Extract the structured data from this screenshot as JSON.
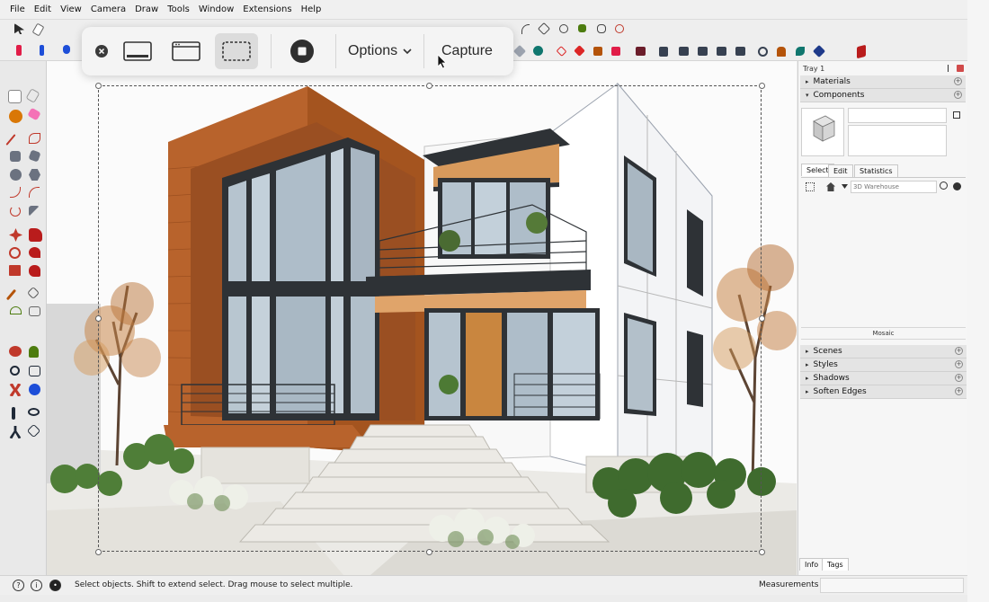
{
  "menu": [
    "File",
    "Edit",
    "View",
    "Camera",
    "Draw",
    "Tools",
    "Window",
    "Extensions",
    "Help"
  ],
  "capture_bar": {
    "options_label": "Options",
    "capture_label": "Capture",
    "options_chevron": "chevron-down-icon"
  },
  "tray": {
    "title": "Tray 1",
    "sections_top": [
      {
        "label": "Materials",
        "arrow": "▸"
      },
      {
        "label": "Components",
        "arrow": "▾"
      }
    ],
    "component_tabs": [
      "Select",
      "Edit",
      "Statistics"
    ],
    "search_placeholder": "3D Warehouse",
    "mosaic_label": "Mosaic",
    "sections_bottom": [
      "Scenes",
      "Styles",
      "Shadows",
      "Soften Edges"
    ],
    "bottom_tabs": [
      "Info",
      "Tags"
    ]
  },
  "status": {
    "hint": "Select objects. Shift to extend select. Drag mouse to select multiple.",
    "measurements_label": "Measurements"
  },
  "colors": {
    "accent": "#c0392b",
    "wood": "#b8632c",
    "frame": "#2e3236"
  }
}
